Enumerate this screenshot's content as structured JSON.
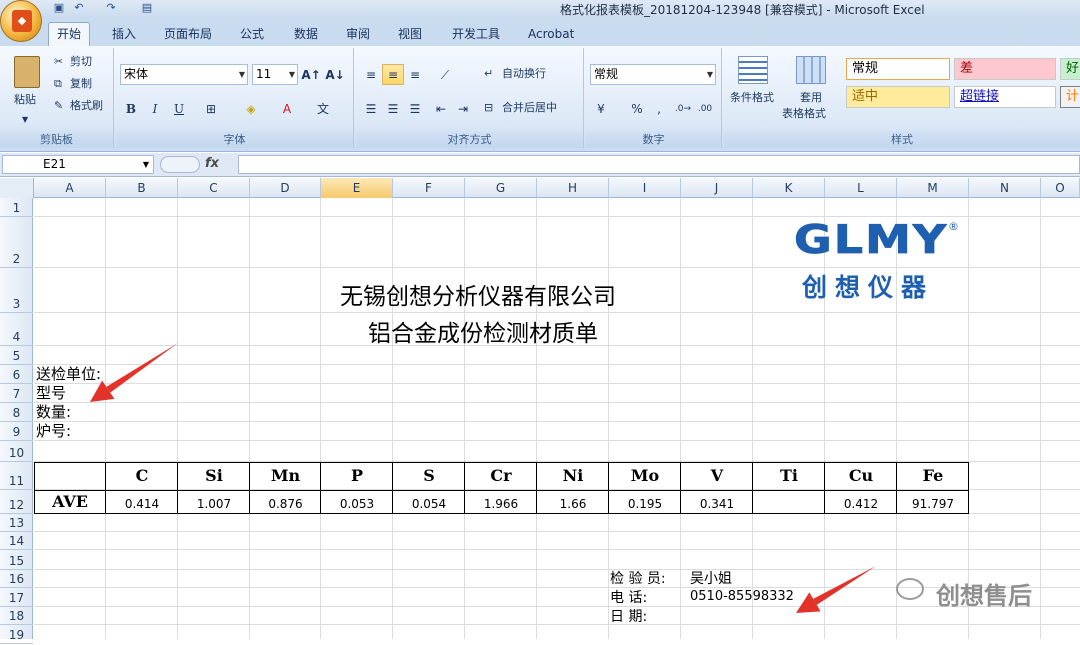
{
  "window": {
    "title": "格式化报表模板_20181204-123948  [兼容模式] - Microsoft Excel"
  },
  "tabs": [
    "开始",
    "插入",
    "页面布局",
    "公式",
    "数据",
    "审阅",
    "视图",
    "开发工具",
    "Acrobat"
  ],
  "ribbon": {
    "clipboard": {
      "paste": "粘贴",
      "cut": "剪切",
      "copy": "复制",
      "format_painter": "格式刷",
      "label": "剪贴板"
    },
    "font": {
      "family": "宋体",
      "size": "11",
      "bold": "B",
      "italic": "I",
      "underline": "U",
      "label": "字体"
    },
    "alignment": {
      "wrap": "自动换行",
      "merge": "合并后居中",
      "label": "对齐方式"
    },
    "number": {
      "format": "常规",
      "label": "数字"
    },
    "styles": {
      "conditional": "条件格式",
      "table_format_1": "套用",
      "table_format_2": "表格格式",
      "normal": "常规",
      "bad": "差",
      "good": "好",
      "neutral": "适中",
      "hyperlink": "超链接",
      "calc": "计",
      "label": "样式"
    }
  },
  "formula_bar": {
    "cell": "E21",
    "fx": "fx",
    "value": ""
  },
  "columns": [
    "A",
    "B",
    "C",
    "D",
    "E",
    "F",
    "G",
    "H",
    "I",
    "J",
    "K",
    "L",
    "M",
    "N",
    "O"
  ],
  "rows": [
    "1",
    "2",
    "3",
    "4",
    "5",
    "6",
    "7",
    "8",
    "9",
    "10",
    "11",
    "12",
    "13",
    "14",
    "15",
    "16",
    "17",
    "18",
    "19"
  ],
  "sheet": {
    "logo": {
      "brand": "GLMY",
      "registered": "®",
      "subtitle": "创想仪器"
    },
    "company": "无锡创想分析仪器有限公司",
    "doc_title": "铝合金成份检测材质单",
    "fields": [
      "送检单位:",
      "型号",
      "数量:",
      "炉号:"
    ],
    "table": {
      "headers": [
        "C",
        "Si",
        "Mn",
        "P",
        "S",
        "Cr",
        "Ni",
        "Mo",
        "V",
        "Ti",
        "Cu",
        "Fe"
      ],
      "row_label": "AVE",
      "values": [
        "0.414",
        "1.007",
        "0.876",
        "0.053",
        "0.054",
        "1.966",
        "1.66",
        "0.195",
        "0.341",
        "",
        "0.412",
        "91.797"
      ]
    },
    "footer": {
      "inspector_label": "检  验  员:",
      "inspector": "吴小姐",
      "phone_label": "电      话:",
      "phone": "0510-85598332",
      "date_label": "日      期:"
    },
    "watermark": "创想售后"
  },
  "colors": {
    "accent": "#1f5fb0",
    "arrow": "#e2322a",
    "grid": "#dadcdd"
  }
}
